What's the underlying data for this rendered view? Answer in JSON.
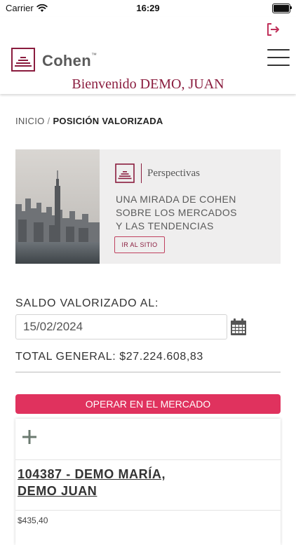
{
  "status_bar": {
    "carrier": "Carrier",
    "time": "16:29"
  },
  "header": {
    "brand_name": "Cohen",
    "brand_tm": "™",
    "welcome_text": "Bienvenido DEMO, JUAN",
    "accent_color": "#8a1c3e"
  },
  "breadcrumb": {
    "home": "INICIO",
    "separator": "/",
    "current": "POSICIÓN VALORIZADA"
  },
  "banner": {
    "brand_label": "Perspectivas",
    "headline_lines": [
      "UNA MIRADA DE COHEN",
      "SOBRE LOS MERCADOS",
      "Y LAS TENDENCIAS"
    ],
    "button_label": "IR AL SITIO"
  },
  "saldo": {
    "label": "SALDO VALORIZADO AL:",
    "date_value": "15/02/2024",
    "total_label": "TOTAL GENERAL: $27.224.608,83"
  },
  "operate_button": {
    "label": "OPERAR EN EL MERCADO",
    "color": "#e0325e"
  },
  "account": {
    "name_line1": "104387 - DEMO MARÍA,",
    "name_line2": "DEMO JUAN ",
    "amount": "$435,40"
  },
  "icons": {
    "status": [
      "wifi-icon",
      "battery-icon"
    ],
    "header": [
      "logout-icon",
      "cohen-logo-icon",
      "menu-icon"
    ],
    "content": [
      "city-photo",
      "calendar-icon",
      "plus-icon"
    ]
  }
}
